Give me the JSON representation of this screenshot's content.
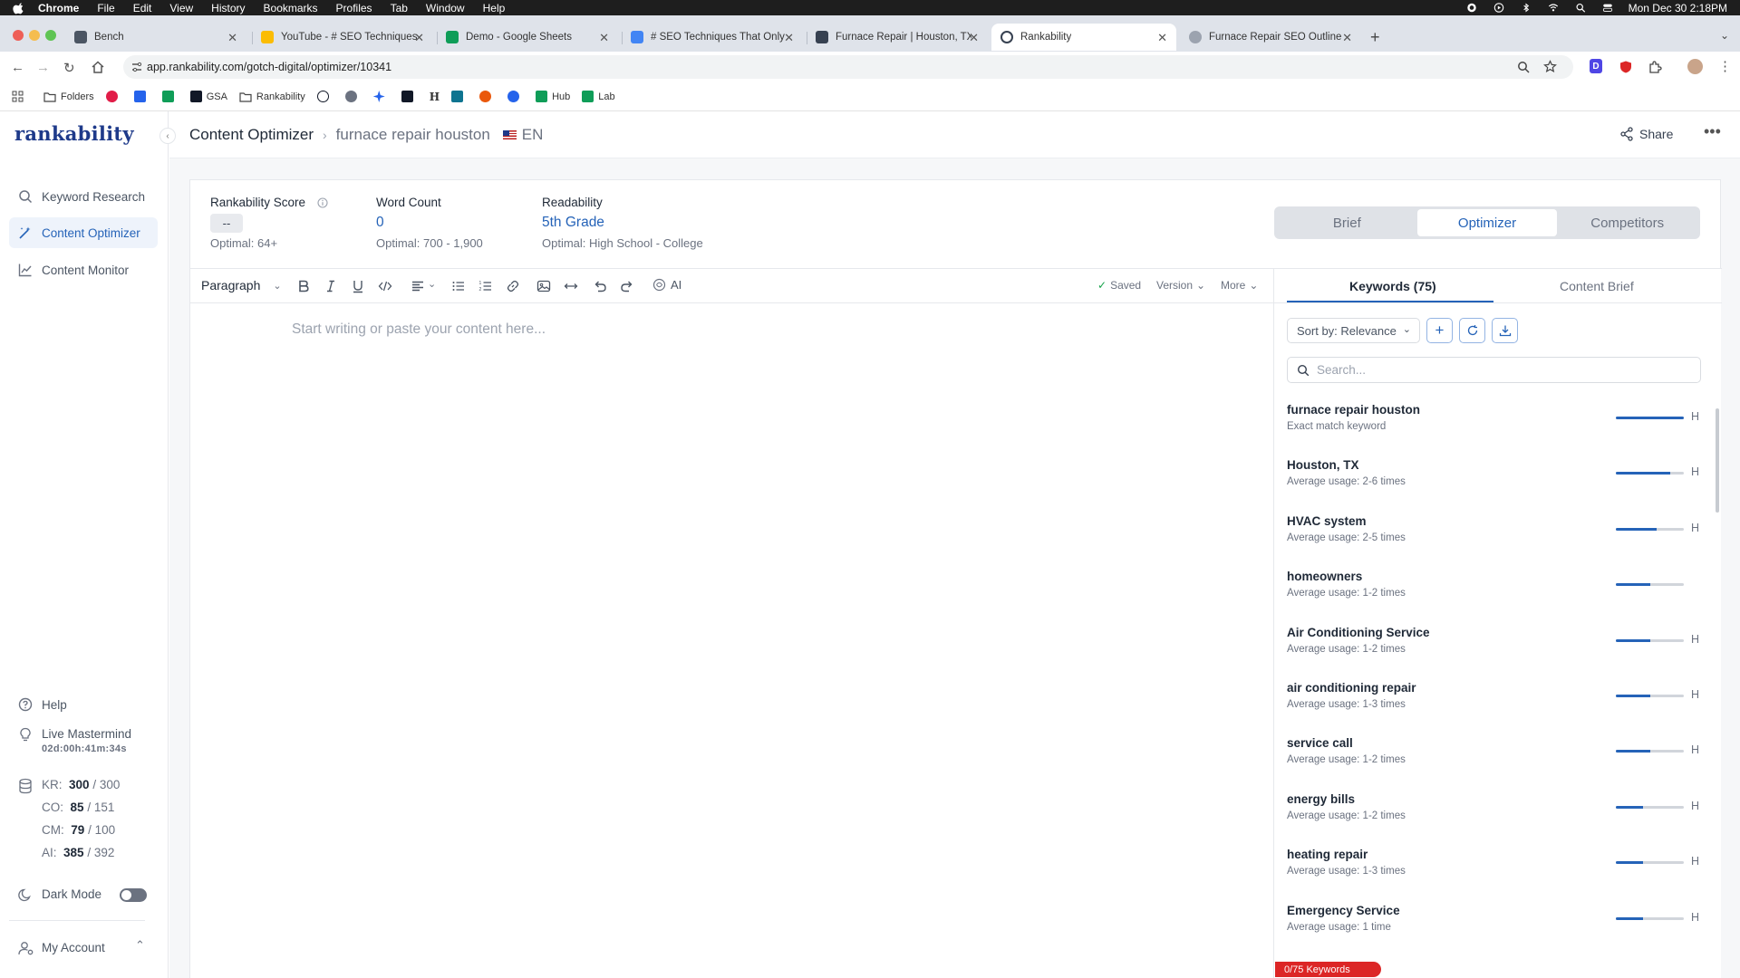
{
  "menubar": {
    "app": "Chrome",
    "items": [
      "File",
      "Edit",
      "View",
      "History",
      "Bookmarks",
      "Profiles",
      "Tab",
      "Window",
      "Help"
    ],
    "datetime": "Mon Dec 30  2:18PM"
  },
  "tabs": [
    {
      "label": "Bench",
      "favicon_color": "#4b5563"
    },
    {
      "label": "YouTube - # SEO Techniques",
      "favicon_color": "#fbbc04"
    },
    {
      "label": "Demo - Google Sheets",
      "favicon_color": "#0f9d58"
    },
    {
      "label": "# SEO Techniques That Only",
      "favicon_color": "#4285f4"
    },
    {
      "label": "Furnace Repair | Houston, TX",
      "favicon_color": "#374151"
    },
    {
      "label": "Rankability",
      "favicon_color": "#374151"
    },
    {
      "label": "Furnace Repair SEO Outline",
      "favicon_color": "#9ca3af"
    }
  ],
  "address": {
    "url": "app.rankability.com/gotch-digital/optimizer/10341"
  },
  "bookmarks": [
    {
      "label": "Folders",
      "color": "#374151"
    },
    {
      "label": "",
      "color": "#e11d48"
    },
    {
      "label": "",
      "color": "#2563eb"
    },
    {
      "label": "",
      "color": "#0f9d58"
    },
    {
      "label": "GSA",
      "color": "#111827"
    },
    {
      "label": "Rankability",
      "color": "#374151"
    },
    {
      "label": "",
      "color": "#111827"
    },
    {
      "label": "",
      "color": "#6b7280"
    },
    {
      "label": "",
      "color": "#2563eb"
    },
    {
      "label": "",
      "color": "#111827"
    },
    {
      "label": "H",
      "color": "#ffffff"
    },
    {
      "label": "",
      "color": "#0e7490"
    },
    {
      "label": "",
      "color": "#ea580c"
    },
    {
      "label": "",
      "color": "#2563eb"
    },
    {
      "label": "Hub",
      "color": "#0f9d58"
    },
    {
      "label": "Lab",
      "color": "#0f9d58"
    }
  ],
  "sidebar": {
    "logo": "rankability",
    "nav": [
      {
        "label": "Keyword Research",
        "icon": "search-icon"
      },
      {
        "label": "Content Optimizer",
        "icon": "magic-wand-icon"
      },
      {
        "label": "Content Monitor",
        "icon": "chart-line-icon"
      }
    ],
    "help": "Help",
    "mastermind": {
      "label": "Live Mastermind",
      "countdown": "02d:00h:41m:34s"
    },
    "quotas": [
      {
        "key": "KR:",
        "used": "300",
        "total": "/ 300"
      },
      {
        "key": "CO:",
        "used": "85",
        "total": "/ 151"
      },
      {
        "key": "CM:",
        "used": "79",
        "total": "/ 100"
      },
      {
        "key": "AI:",
        "used": "385",
        "total": "/ 392"
      }
    ],
    "dark_mode": "Dark Mode",
    "account": "My Account"
  },
  "header": {
    "title": "Content Optimizer",
    "keyword": "furnace repair houston",
    "lang": "EN",
    "share": "Share"
  },
  "metrics": {
    "score": {
      "label": "Rankability Score",
      "value": "--",
      "optimal": "Optimal: 64+"
    },
    "word_count": {
      "label": "Word Count",
      "value": "0",
      "optimal": "Optimal: 700 - 1,900"
    },
    "readability": {
      "label": "Readability",
      "value": "5th Grade",
      "optimal": "Optimal: High School - College"
    }
  },
  "view_tabs": {
    "brief": "Brief",
    "optimizer": "Optimizer",
    "competitors": "Competitors"
  },
  "toolbar": {
    "paragraph": "Paragraph",
    "ai": "AI",
    "saved": "Saved",
    "version": "Version",
    "more": "More"
  },
  "editor": {
    "placeholder": "Start writing or paste your content here..."
  },
  "panel": {
    "tab_keywords": "Keywords (75)",
    "tab_brief": "Content Brief",
    "sort": "Sort by: Relevance",
    "search_placeholder": "Search...",
    "keyword_count": "0/75 Keywords",
    "keywords": [
      {
        "name": "furnace repair houston",
        "usage": "Exact match keyword",
        "level": 1.0,
        "tag": "H"
      },
      {
        "name": "Houston, TX",
        "usage": "Average usage: 2-6 times",
        "level": 0.8,
        "tag": "H"
      },
      {
        "name": "HVAC system",
        "usage": "Average usage: 2-5 times",
        "level": 0.6,
        "tag": "H"
      },
      {
        "name": "homeowners",
        "usage": "Average usage: 1-2 times",
        "level": 0.5,
        "tag": ""
      },
      {
        "name": "Air Conditioning Service",
        "usage": "Average usage: 1-2 times",
        "level": 0.5,
        "tag": "H"
      },
      {
        "name": "air conditioning repair",
        "usage": "Average usage: 1-3 times",
        "level": 0.5,
        "tag": "H"
      },
      {
        "name": "service call",
        "usage": "Average usage: 1-2 times",
        "level": 0.5,
        "tag": "H"
      },
      {
        "name": "energy bills",
        "usage": "Average usage: 1-2 times",
        "level": 0.4,
        "tag": "H"
      },
      {
        "name": "heating repair",
        "usage": "Average usage: 1-3 times",
        "level": 0.4,
        "tag": "H"
      },
      {
        "name": "Emergency Service",
        "usage": "Average usage: 1 time",
        "level": 0.4,
        "tag": "H"
      }
    ]
  }
}
